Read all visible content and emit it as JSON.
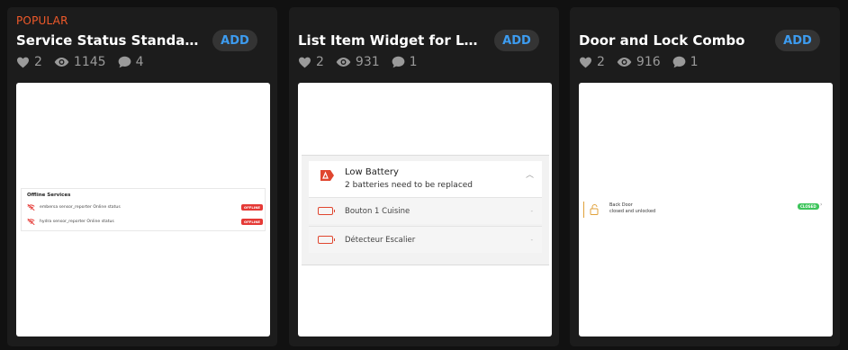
{
  "cards": [
    {
      "badge": "POPULAR",
      "title": "Service Status Standalone",
      "add_label": "ADD",
      "likes": "2",
      "views": "1145",
      "comments": "4",
      "preview": {
        "heading": "Offline Services",
        "rows": [
          {
            "text": "embersa sensor_reporter Online status",
            "status": "OFFLINE"
          },
          {
            "text": "hydra sensor_reporter Online status",
            "status": "OFFLINE"
          }
        ]
      }
    },
    {
      "badge": "",
      "title": "List Item Widget for Low Battery",
      "add_label": "ADD",
      "likes": "2",
      "views": "931",
      "comments": "1",
      "preview": {
        "heading": "Low Battery",
        "subheading": "2 batteries need to be replaced",
        "rows": [
          {
            "label": "Bouton 1 Cuisine",
            "value": "-"
          },
          {
            "label": "Détecteur Escalier",
            "value": "-"
          }
        ]
      }
    },
    {
      "badge": "",
      "title": "Door and Lock Combo",
      "add_label": "ADD",
      "likes": "2",
      "views": "916",
      "comments": "1",
      "preview": {
        "door_title": "Back Door",
        "door_sub": "closed and unlocked",
        "status": "CLOSED"
      }
    }
  ],
  "colors": {
    "accent": "#3d9cf0",
    "popular": "#f25a2a",
    "offline": "#e53935",
    "closed": "#3ec55c",
    "battery": "#e0462f"
  },
  "icons": [
    "heart-icon",
    "eye-icon",
    "comment-icon",
    "wifi-off-icon",
    "battery-warning-icon",
    "battery-icon",
    "lock-open-icon",
    "chevron-up-icon",
    "chevron-right-icon"
  ]
}
